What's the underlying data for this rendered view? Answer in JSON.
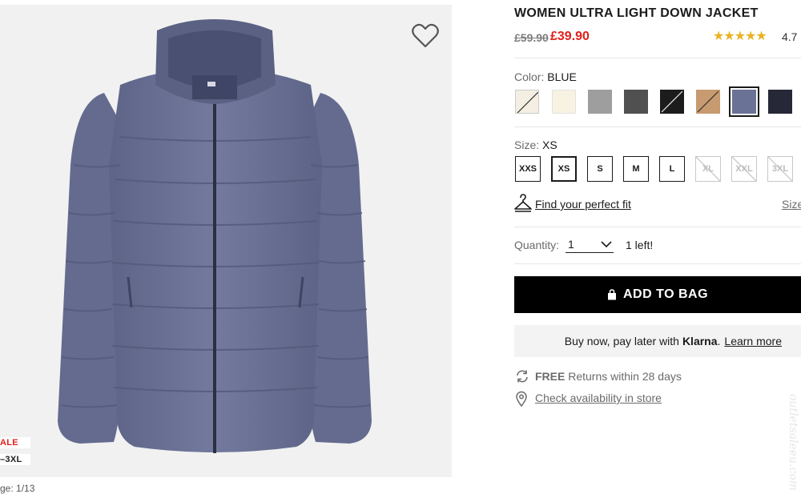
{
  "product": {
    "title": "WOMEN ULTRA LIGHT DOWN JACKET",
    "old_price": "£59.90",
    "new_price": "£39.90",
    "stars": "★★★★★",
    "rating": "4.7"
  },
  "gallery": {
    "sale_tag": "ALE",
    "size_range_tag": "–3XL",
    "image_counter": "ge: 1/13"
  },
  "color": {
    "label": "Color:",
    "selected": "BLUE",
    "swatches": [
      {
        "name": "off-white",
        "hex": "#f4efe2",
        "slashed": true
      },
      {
        "name": "cream",
        "hex": "#f7f2e2",
        "slashed": false
      },
      {
        "name": "light-gray",
        "hex": "#9e9e9e",
        "slashed": false
      },
      {
        "name": "dark-gray",
        "hex": "#505050",
        "slashed": false
      },
      {
        "name": "black",
        "hex": "#1c1c1c",
        "slashed": true
      },
      {
        "name": "camel",
        "hex": "#c79a6f",
        "slashed": true
      },
      {
        "name": "blue",
        "hex": "#6a7296",
        "slashed": false,
        "selected": true
      },
      {
        "name": "navy",
        "hex": "#262838",
        "slashed": false
      }
    ]
  },
  "size": {
    "label": "Size:",
    "selected": "XS",
    "options": [
      {
        "label": "XXS",
        "available": true
      },
      {
        "label": "XS",
        "available": true,
        "selected": true
      },
      {
        "label": "S",
        "available": true
      },
      {
        "label": "M",
        "available": true
      },
      {
        "label": "L",
        "available": true
      },
      {
        "label": "XL",
        "available": false
      },
      {
        "label": "XXL",
        "available": false
      },
      {
        "label": "3XL",
        "available": false
      }
    ],
    "fit_link": "Find your perfect fit",
    "guide_link": "Size"
  },
  "quantity": {
    "label": "Quantity:",
    "value": "1",
    "stock_note": "1 left!"
  },
  "cart": {
    "add_label": "ADD TO BAG"
  },
  "klarna": {
    "text": "Buy now, pay later with",
    "brand": "Klarna",
    "period": ".",
    "learn_more": "Learn more"
  },
  "features": {
    "returns_bold": "FREE",
    "returns_text": " Returns within 28 days",
    "availability": "Check availability in store"
  },
  "watermark": "outletsaleeu.com",
  "colors": {
    "sale_red": "#e0201b",
    "star_gold": "#e9b322",
    "jacket_blue": "#6a7296",
    "image_bg": "#f1f1f1"
  }
}
